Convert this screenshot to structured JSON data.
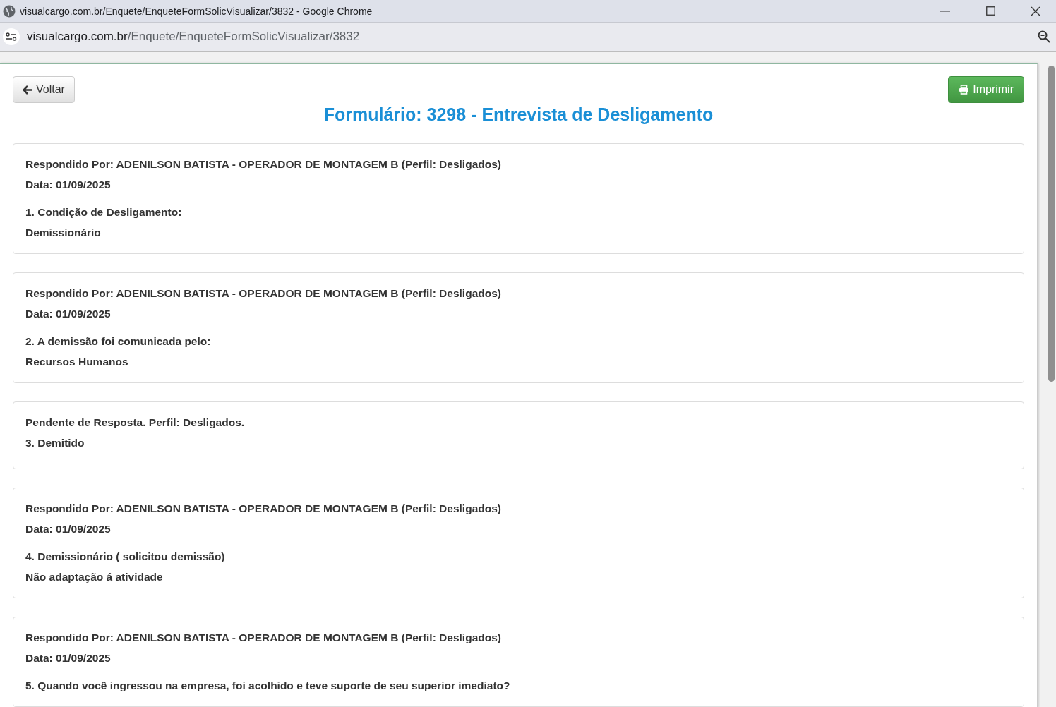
{
  "window": {
    "title": "visualcargo.com.br/Enquete/EnqueteFormSolicVisualizar/3832 - Google Chrome"
  },
  "address_bar": {
    "host": "visualcargo.com.br",
    "path": "/Enquete/EnqueteFormSolicVisualizar/3832"
  },
  "toolbar": {
    "back_button": "Voltar",
    "print_button": "Imprimir"
  },
  "title": "Formulário: 3298 - Entrevista de Desligamento",
  "cards": [
    {
      "kind": "answered",
      "respondent": "Respondido Por: ADENILSON BATISTA - OPERADOR DE MONTAGEM B (Perfil: Desligados)",
      "date": "Data: 01/09/2025",
      "question": "1. Condição de Desligamento:",
      "answer": "Demissionário"
    },
    {
      "kind": "answered",
      "respondent": "Respondido Por: ADENILSON BATISTA - OPERADOR DE MONTAGEM B (Perfil: Desligados)",
      "date": "Data: 01/09/2025",
      "question": "2. A demissão foi comunicada pelo:",
      "answer": "Recursos Humanos"
    },
    {
      "kind": "pending",
      "status": "Pendente de Resposta. Perfil: Desligados.",
      "question": "3. Demitido"
    },
    {
      "kind": "answered",
      "respondent": "Respondido Por: ADENILSON BATISTA - OPERADOR DE MONTAGEM B (Perfil: Desligados)",
      "date": "Data: 01/09/2025",
      "question": "4. Demissionário ( solicitou demissão)",
      "answer": "Não adaptação á atividade"
    },
    {
      "kind": "answered",
      "respondent": "Respondido Por: ADENILSON BATISTA - OPERADOR DE MONTAGEM B (Perfil: Desligados)",
      "date": "Data: 01/09/2025",
      "question": "5. Quando você ingressou na empresa, foi acolhido e teve suporte de seu superior imediato?"
    }
  ]
}
